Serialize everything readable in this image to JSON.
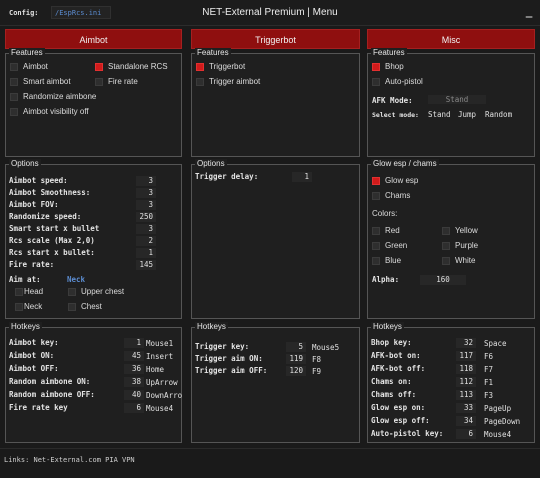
{
  "titlebar": {
    "config_label": "Config:",
    "config_value": "/EspRcs.ini",
    "title": "NET-External Premium | Menu",
    "minimize": "_"
  },
  "columns": {
    "aimbot": "Aimbot",
    "triggerbot": "Triggerbot",
    "misc": "Misc"
  },
  "aimbot": {
    "features_title": "Features",
    "features": [
      {
        "label": "Aimbot",
        "checked": false
      },
      {
        "label": "Standalone RCS",
        "checked": true
      },
      {
        "label": "Smart aimbot",
        "checked": false
      },
      {
        "label": "Fire rate",
        "checked": false
      },
      {
        "label": "Randomize aimbone",
        "checked": false
      },
      {
        "label": "Aimbot visibility off",
        "checked": false
      }
    ],
    "options_title": "Options",
    "options": [
      {
        "label": "Aimbot speed:",
        "value": "3"
      },
      {
        "label": "Aimbot Smoothness:",
        "value": "3"
      },
      {
        "label": "Aimbot FOV:",
        "value": "3"
      },
      {
        "label": "Randomize speed:",
        "value": "250"
      },
      {
        "label": "Smart start x bullet",
        "value": "3"
      },
      {
        "label": "Rcs scale (Max 2,0)",
        "value": "2"
      },
      {
        "label": "Rcs start x bullet:",
        "value": "1"
      },
      {
        "label": "Fire rate:",
        "value": "145"
      }
    ],
    "aim_at_label": "Aim at:",
    "aim_at_value": "Neck",
    "aim_targets": [
      {
        "label": "Head",
        "checked": false
      },
      {
        "label": "Upper chest",
        "checked": false
      },
      {
        "label": "Neck",
        "checked": false
      },
      {
        "label": "Chest",
        "checked": false
      }
    ],
    "hotkeys_title": "Hotkeys",
    "hotkeys": [
      {
        "label": "Aimbot key:",
        "code": "1",
        "key": "Mouse1"
      },
      {
        "label": "Aimbot ON:",
        "code": "45",
        "key": "Insert"
      },
      {
        "label": "Aimbot OFF:",
        "code": "36",
        "key": "Home"
      },
      {
        "label": "Random aimbone ON:",
        "code": "38",
        "key": "UpArrow"
      },
      {
        "label": "Random aimbone OFF:",
        "code": "40",
        "key": "DownArro"
      },
      {
        "label": "Fire rate key",
        "code": "6",
        "key": "Mouse4"
      }
    ]
  },
  "triggerbot": {
    "features_title": "Features",
    "features": [
      {
        "label": "Triggerbot",
        "checked": true
      },
      {
        "label": "Trigger aimbot",
        "checked": false
      }
    ],
    "options_title": "Options",
    "options": [
      {
        "label": "Trigger delay:",
        "value": "1"
      }
    ],
    "hotkeys_title": "Hotkeys",
    "hotkeys": [
      {
        "label": "Trigger key:",
        "code": "5",
        "key": "Mouse5"
      },
      {
        "label": "Trigger aim ON:",
        "code": "119",
        "key": "F8"
      },
      {
        "label": "Trigger aim OFF:",
        "code": "120",
        "key": "F9"
      }
    ]
  },
  "misc": {
    "features_title": "Features",
    "features": [
      {
        "label": "Bhop",
        "checked": true
      },
      {
        "label": "Auto-pistol",
        "checked": false
      }
    ],
    "afk_mode_label": "AFK Mode:",
    "afk_mode_value": "Stand",
    "select_mode_label": "Select mode:",
    "select_modes": [
      "Stand",
      "Jump",
      "Random"
    ],
    "glow_title": "Glow esp / chams",
    "glow_features": [
      {
        "label": "Glow esp",
        "checked": true
      },
      {
        "label": "Chams",
        "checked": false
      }
    ],
    "colors_label": "Colors:",
    "colors": [
      {
        "label": "Red",
        "checked": false
      },
      {
        "label": "Yellow",
        "checked": false
      },
      {
        "label": "Green",
        "checked": false
      },
      {
        "label": "Purple",
        "checked": false
      },
      {
        "label": "Blue",
        "checked": false
      },
      {
        "label": "White",
        "checked": false
      }
    ],
    "alpha_label": "Alpha:",
    "alpha_value": "160",
    "hotkeys_title": "Hotkeys",
    "hotkeys": [
      {
        "label": "Bhop key:",
        "code": "32",
        "key": "Space"
      },
      {
        "label": "AFK-bot on:",
        "code": "117",
        "key": "F6"
      },
      {
        "label": "AFK-bot off:",
        "code": "118",
        "key": "F7"
      },
      {
        "label": "Chams on:",
        "code": "112",
        "key": "F1"
      },
      {
        "label": "Chams off:",
        "code": "113",
        "key": "F3"
      },
      {
        "label": "Glow esp on:",
        "code": "33",
        "key": "PageUp"
      },
      {
        "label": "Glow esp off:",
        "code": "34",
        "key": "PageDown"
      },
      {
        "label": "Auto-pistol key:",
        "code": "6",
        "key": "Mouse4"
      }
    ]
  },
  "footer": {
    "links": "Links: Net-External.com PIA VPN"
  },
  "colors": {
    "accent": "#8f0f0f",
    "checked": "#d11b1b",
    "link": "#5b8cd0"
  }
}
